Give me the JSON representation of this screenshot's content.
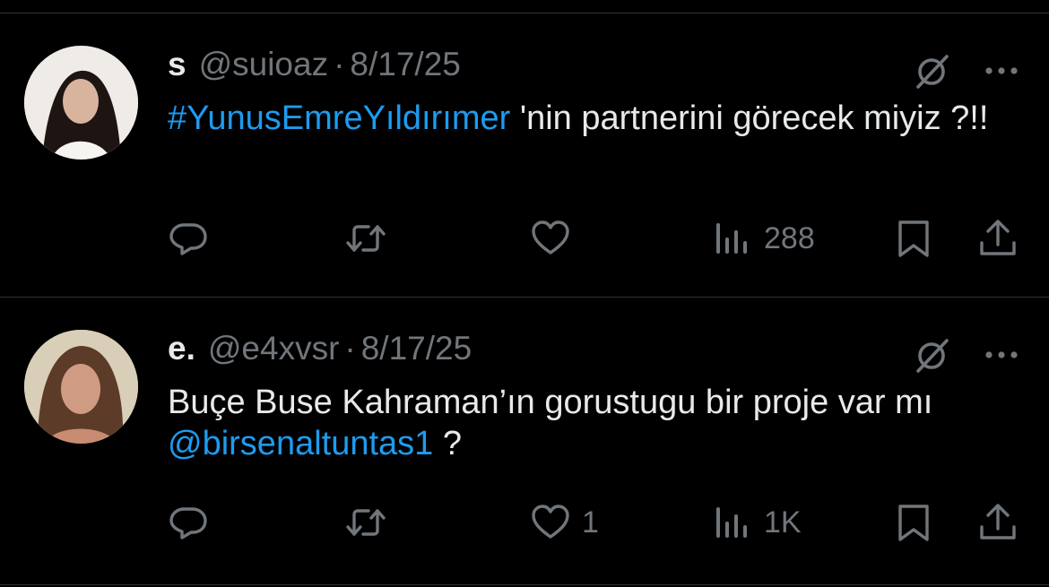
{
  "tweets": [
    {
      "display_name": "s",
      "handle": "@suioaz",
      "separator": "·",
      "date": "8/17/25",
      "text_segments": [
        {
          "text": "#YunusEmreYıldırımer",
          "link": true
        },
        {
          "text": " 'nin partnerini görecek miyiz ?!!",
          "link": false
        }
      ],
      "actions": {
        "reply_icon": "reply-icon",
        "retweet_icon": "retweet-icon",
        "like_icon": "heart-icon",
        "like_count": "",
        "views_icon": "views-icon",
        "views_count": "288",
        "bookmark_icon": "bookmark-icon",
        "share_icon": "share-icon"
      }
    },
    {
      "display_name": "e.",
      "handle": "@e4xvsr",
      "separator": "·",
      "date": "8/17/25",
      "text_segments": [
        {
          "text": "Buçe Buse Kahraman’ın gorustugu bir proje var mı ",
          "link": false
        },
        {
          "text": "@birsenaltuntas1",
          "link": true
        },
        {
          "text": " ?",
          "link": false
        }
      ],
      "actions": {
        "reply_icon": "reply-icon",
        "retweet_icon": "retweet-icon",
        "like_icon": "heart-icon",
        "like_count": "1",
        "views_icon": "views-icon",
        "views_count": "1K",
        "bookmark_icon": "bookmark-icon",
        "share_icon": "share-icon"
      }
    }
  ],
  "colors": {
    "background": "#000000",
    "text": "#e7e9ea",
    "muted": "#71767b",
    "link": "#1d9bf0",
    "divider": "#2f3336"
  }
}
